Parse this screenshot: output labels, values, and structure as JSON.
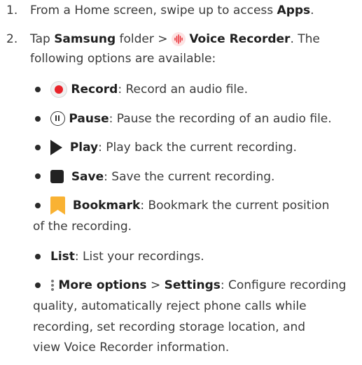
{
  "steps": [
    {
      "number": "1.",
      "pre": "From a Home screen, swipe up to access ",
      "bold": "Apps",
      "post": "."
    },
    {
      "number": "2.",
      "pre": "Tap ",
      "bold1": "Samsung",
      "mid": " folder > ",
      "icon": "voice-recorder-icon",
      "bold2": "Voice Recorder",
      "post": ". The",
      "cont": "following options are available:"
    }
  ],
  "options": [
    {
      "icon": "record-icon",
      "term": "Record",
      "desc": ": Record an audio file."
    },
    {
      "icon": "pause-icon",
      "term": "Pause",
      "desc": ": Pause the recording of an audio file."
    },
    {
      "icon": "play-icon",
      "term": "Play",
      "desc": ": Play back the current recording."
    },
    {
      "icon": "stop-icon",
      "term": "Save",
      "desc": ": Save the current recording."
    },
    {
      "icon": "bookmark-icon",
      "term": "Bookmark",
      "desc": ": Bookmark the current position",
      "cont": "of the recording."
    },
    {
      "term": "List",
      "desc": ": List your recordings."
    },
    {
      "icon": "more-options-icon",
      "term": "More options",
      "sep": " > ",
      "term2": "Settings",
      "desc": ": Configure recording",
      "cont": [
        "quality, automatically reject phone calls while",
        "recording, set recording storage location, and",
        "view Voice Recorder information."
      ]
    }
  ],
  "colors": {
    "record": "#e8232a",
    "bookmark": "#f9b233",
    "voice_recorder": "#e8232a"
  }
}
